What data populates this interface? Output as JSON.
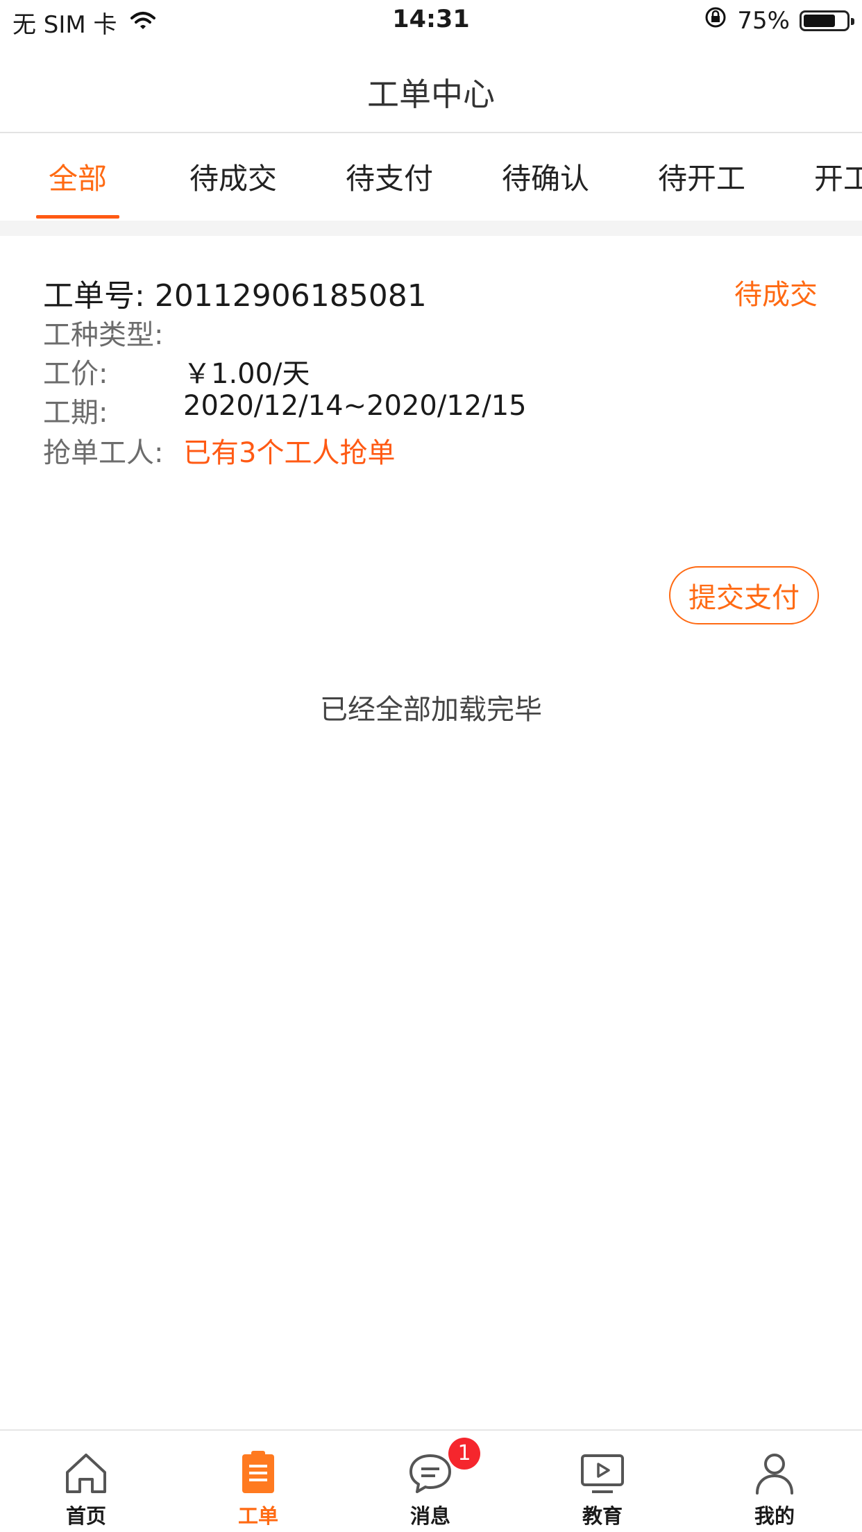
{
  "status_bar": {
    "carrier": "无 SIM 卡",
    "time": "14:31",
    "battery_percent": "75%",
    "battery_level": 0.75
  },
  "header": {
    "title": "工单中心"
  },
  "tabs": [
    {
      "label": "全部",
      "active": true
    },
    {
      "label": "待成交",
      "active": false
    },
    {
      "label": "待支付",
      "active": false
    },
    {
      "label": "待确认",
      "active": false
    },
    {
      "label": "待开工",
      "active": false
    },
    {
      "label": "开工",
      "active": false
    }
  ],
  "order": {
    "number_label": "工单号:",
    "number": "20112906185081",
    "status": "待成交",
    "fields": [
      {
        "label": "工种类型:",
        "value": ""
      },
      {
        "label": "工价:",
        "value": "￥1.00/天"
      },
      {
        "label": "工期:",
        "value": "2020/12/14~2020/12/15"
      },
      {
        "label": "抢单工人:",
        "value": "已有3个工人抢单"
      }
    ],
    "action_button": "提交支付"
  },
  "list_footer": "已经全部加载完毕",
  "bottom_nav": [
    {
      "label": "首页",
      "icon": "home-icon",
      "active": false
    },
    {
      "label": "工单",
      "icon": "clipboard-icon",
      "active": true
    },
    {
      "label": "消息",
      "icon": "chat-bubble-icon",
      "active": false,
      "badge": "1"
    },
    {
      "label": "教育",
      "icon": "video-play-icon",
      "active": false
    },
    {
      "label": "我的",
      "icon": "person-icon",
      "active": false
    }
  ],
  "colors": {
    "accent": "#ff6a13",
    "badge": "#f5262d",
    "muted_text": "#6c6c6c"
  }
}
